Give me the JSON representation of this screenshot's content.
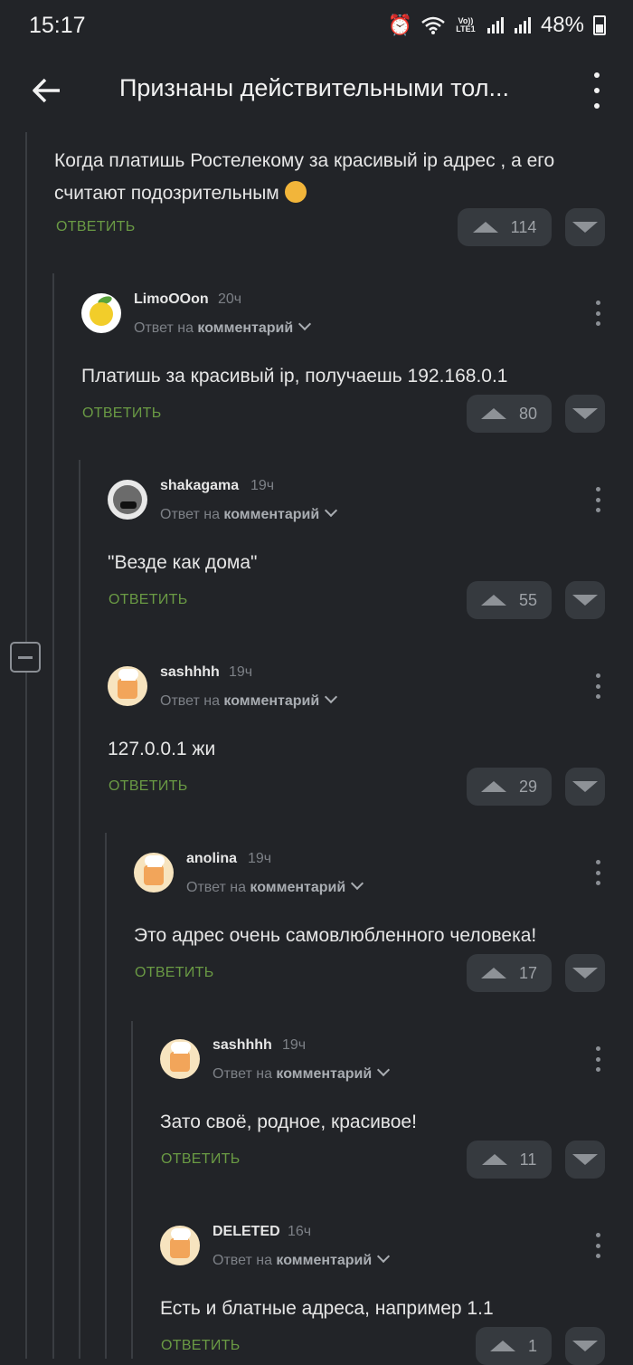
{
  "status_bar": {
    "time": "15:17",
    "lte_label": "Vo)) LTE1",
    "battery": "48%"
  },
  "app_bar": {
    "title": "Признаны действительными тол..."
  },
  "top_comment": {
    "text": "Когда платишь Ростелекому за красивый ip адрес , а его считают подозрительным",
    "reply_label": "ОТВЕТИТЬ",
    "votes": "114"
  },
  "comments": [
    {
      "username": "LimoOOon",
      "time": "20ч",
      "reply_prefix": "Ответ на",
      "reply_link": "комментарий",
      "text": "Платишь за красивый ip, получаешь 192.168.0.1",
      "reply_label": "ОТВЕТИТЬ",
      "votes": "80"
    },
    {
      "username": "shakagama",
      "time": "19ч",
      "reply_prefix": "Ответ на",
      "reply_link": "комментарий",
      "text": "\"Везде как дома\"",
      "reply_label": "ОТВЕТИТЬ",
      "votes": "55"
    },
    {
      "username": "sashhhh",
      "time": "19ч",
      "reply_prefix": "Ответ на",
      "reply_link": "комментарий",
      "text": "127.0.0.1 жи",
      "reply_label": "ОТВЕТИТЬ",
      "votes": "29"
    },
    {
      "username": "anolina",
      "time": "19ч",
      "reply_prefix": "Ответ на",
      "reply_link": "комментарий",
      "text": "Это адрес очень самовлюбленного человека!",
      "reply_label": "ОТВЕТИТЬ",
      "votes": "17"
    },
    {
      "username": "sashhhh",
      "time": "19ч",
      "reply_prefix": "Ответ на",
      "reply_link": "комментарий",
      "text": "Зато своё, родное, красивое!",
      "reply_label": "ОТВЕТИТЬ",
      "votes": "11"
    },
    {
      "username": "DELETED",
      "time": "16ч",
      "reply_prefix": "Ответ на",
      "reply_link": "комментарий",
      "text": "Есть и блатные адреса, например 1.1",
      "reply_label": "ОТВЕТИТЬ",
      "votes": "1"
    }
  ]
}
